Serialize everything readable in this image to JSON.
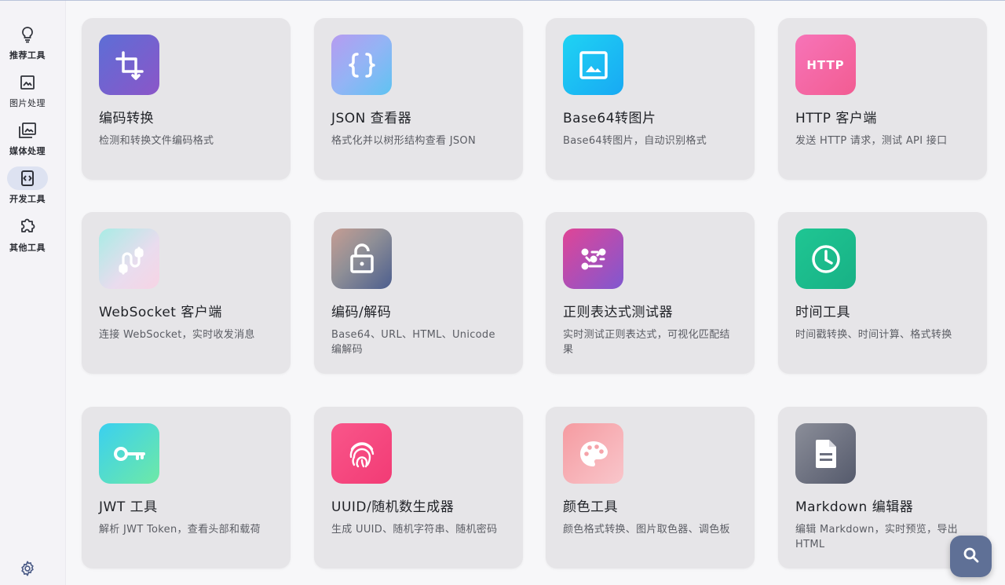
{
  "sidebar": {
    "items": [
      {
        "label": "推荐工具",
        "icon": "lightbulb-icon"
      },
      {
        "label": "图片处理",
        "icon": "image-icon"
      },
      {
        "label": "媒体处理",
        "icon": "photo-library-icon"
      },
      {
        "label": "开发工具",
        "icon": "code-brackets-icon",
        "active": true
      },
      {
        "label": "其他工具",
        "icon": "puzzle-icon"
      }
    ],
    "settings_icon": "gear-icon"
  },
  "cards": [
    {
      "title": "编码转换",
      "desc": "检测和转换文件编码格式",
      "icon": "crop-rotate-icon",
      "colors": [
        "#5d6ed6",
        "#8b56c8"
      ]
    },
    {
      "title": "JSON 查看器",
      "desc": "格式化并以树形结构查看 JSON",
      "icon": "curly-braces-icon",
      "colors": [
        "#b69bf0",
        "#5fc3f2"
      ]
    },
    {
      "title": "Base64转图片",
      "desc": "Base64转图片，自动识别格式",
      "icon": "image-frame-icon",
      "colors": [
        "#1fd3f3",
        "#18a9f3"
      ]
    },
    {
      "title": "HTTP 客户端",
      "desc": "发送 HTTP 请求，测试 API 接口",
      "icon": "http-icon",
      "colors": [
        "#f774b8",
        "#f25c92"
      ]
    },
    {
      "title": "WebSocket 客户端",
      "desc": "连接 WebSocket，实时收发消息",
      "icon": "cable-plug-icon",
      "colors": [
        "#a8ece5",
        "#f7d4e4"
      ]
    },
    {
      "title": "编码/解码",
      "desc": "Base64、URL、HTML、Unicode 编解码",
      "icon": "lock-open-icon",
      "colors": [
        "#c69d93",
        "#4c5e8e"
      ]
    },
    {
      "title": "正则表达式测试器",
      "desc": "实时测试正则表达式，可视化匹配结果",
      "icon": "regex-dots-icon",
      "colors": [
        "#e04596",
        "#7f58d0"
      ]
    },
    {
      "title": "时间工具",
      "desc": "时间戳转换、时间计算、格式转换",
      "icon": "clock-icon",
      "colors": [
        "#1fc693",
        "#18b185"
      ]
    },
    {
      "title": "JWT 工具",
      "desc": "解析 JWT Token，查看头部和载荷",
      "icon": "key-icon",
      "colors": [
        "#3ad0f0",
        "#6ee9a6"
      ]
    },
    {
      "title": "UUID/随机数生成器",
      "desc": "生成 UUID、随机字符串、随机密码",
      "icon": "fingerprint-icon",
      "colors": [
        "#f9568a",
        "#f23b75"
      ]
    },
    {
      "title": "颜色工具",
      "desc": "颜色格式转换、图片取色器、调色板",
      "icon": "palette-icon",
      "colors": [
        "#f59ba1",
        "#f9c6cb"
      ]
    },
    {
      "title": "Markdown 编辑器",
      "desc": "编辑 Markdown，实时预览，导出HTML",
      "icon": "document-icon",
      "colors": [
        "#8b8e99",
        "#555a6c"
      ]
    }
  ],
  "http_label": "HTTP",
  "fab": {
    "icon": "search-icon",
    "color": "#5f7096"
  }
}
